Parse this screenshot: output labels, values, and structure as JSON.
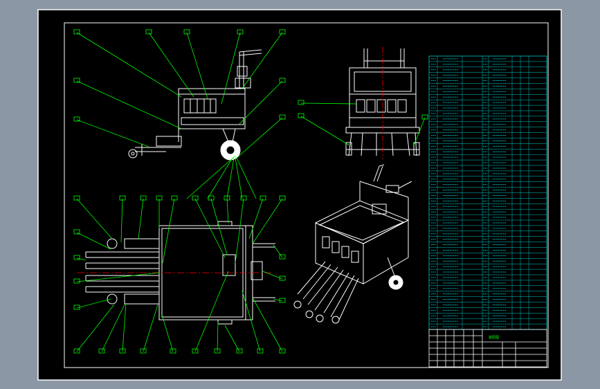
{
  "theme": {
    "background": "#8c97a6",
    "sheet": "#000000",
    "frame": "#ffffff",
    "leader": "#00ff00",
    "bom_grid": "#00c8c8",
    "center_line": "#ff0000",
    "part_line": "#ffffff",
    "wheel_fill": "#ffffff"
  },
  "bom": {
    "rows": 50,
    "title_text": "装配图",
    "legible": false
  },
  "views": {
    "side": "side-elevation",
    "front": "front-elevation",
    "top": "plan-view",
    "iso": "isometric-view"
  }
}
